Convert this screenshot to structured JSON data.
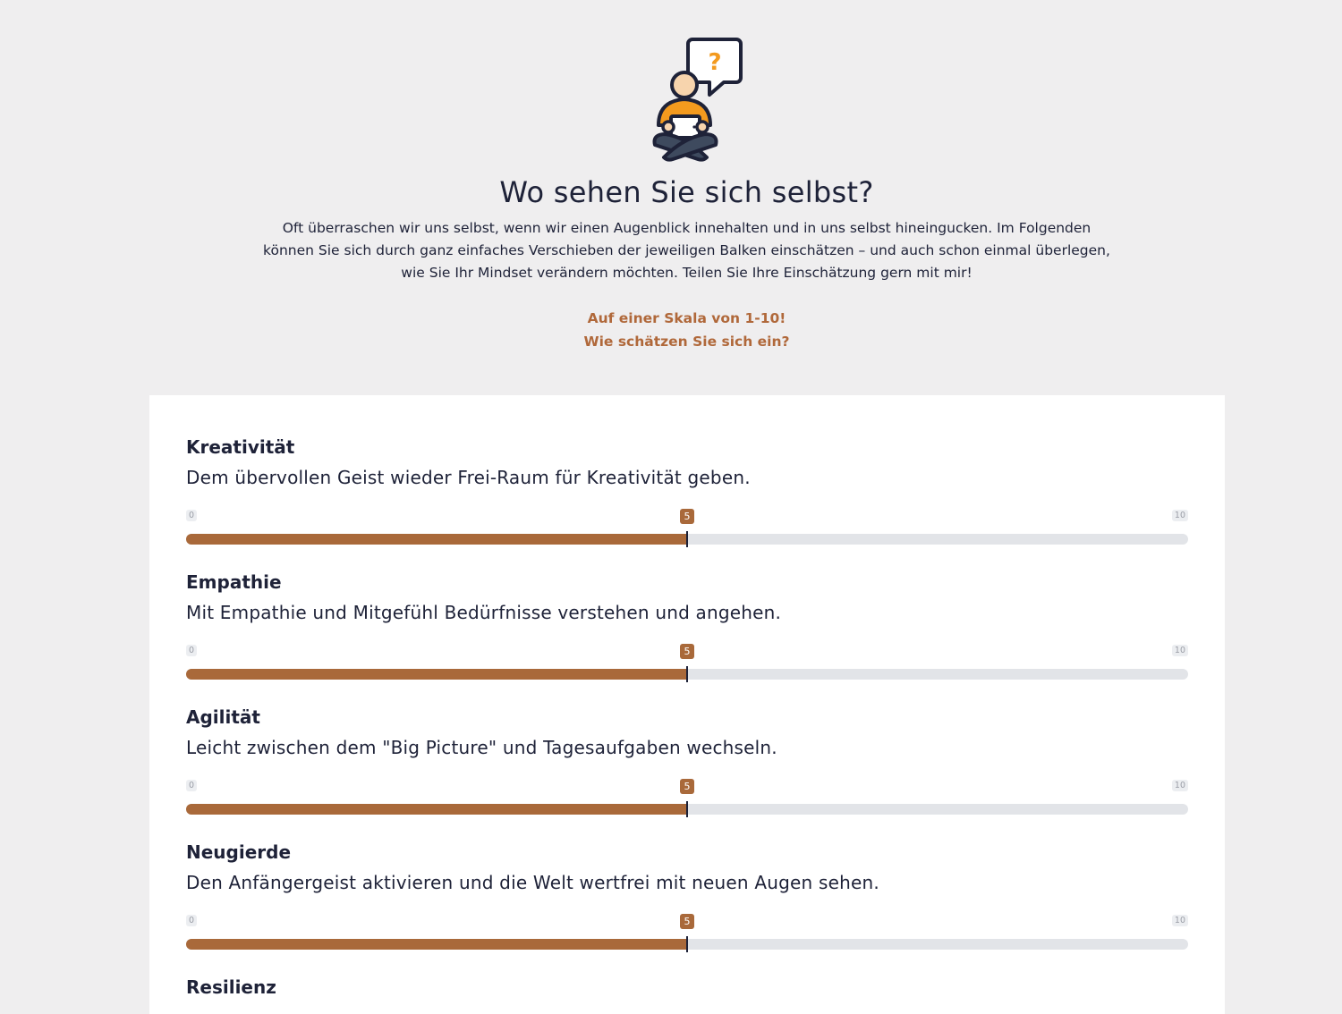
{
  "hero": {
    "illustration_icon": "person-with-tablet-question-icon",
    "headline": "Wo sehen Sie sich selbst?",
    "intro_lines": [
      "Oft überraschen wir uns selbst, wenn wir einen Augenblick innehalten und in uns selbst hineingucken. Im Folgenden",
      "können Sie sich durch ganz einfaches Verschieben der jeweiligen Balken einschätzen – und auch schon einmal überlegen,",
      "wie Sie Ihr Mindset verändern möchten. Teilen Sie Ihre Einschätzung gern mit mir!"
    ],
    "scale_note_line1": "Auf einer Skala von 1-10!",
    "scale_note_line2": "Wie schätzen Sie sich ein?"
  },
  "colors": {
    "accent": "#a9693a",
    "text": "#1e2238",
    "background": "#efeeef",
    "track": "#e2e4e8",
    "illustration_orange": "#f39a1e"
  },
  "ratings": [
    {
      "title": "Kreativität",
      "description": "Dem übervollen Geist wieder Frei-Raum für Kreativität geben.",
      "min_label": "0",
      "max_label": "10",
      "value_label": "5",
      "value_fraction": 0.5
    },
    {
      "title": "Empathie",
      "description": "Mit Empathie und Mitgefühl Bedürfnisse verstehen und angehen.",
      "min_label": "0",
      "max_label": "10",
      "value_label": "5",
      "value_fraction": 0.5
    },
    {
      "title": "Agilität",
      "description": "Leicht zwischen dem \"Big Picture\" und Tagesaufgaben wechseln.",
      "min_label": "0",
      "max_label": "10",
      "value_label": "5",
      "value_fraction": 0.5
    },
    {
      "title": "Neugierde",
      "description": "Den Anfängergeist aktivieren und die Welt wertfrei mit neuen Augen sehen.",
      "min_label": "0",
      "max_label": "10",
      "value_label": "5",
      "value_fraction": 0.5
    },
    {
      "title": "Resilienz"
    }
  ]
}
